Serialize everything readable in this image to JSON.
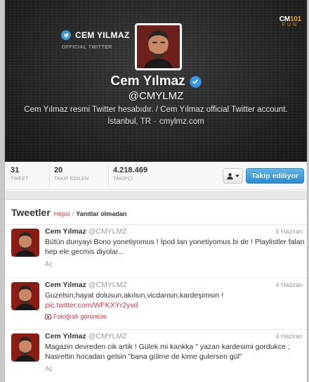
{
  "header": {
    "brand_name": "CEM YILMAZ",
    "brand_sub": "OFFICIAL TWITTER",
    "cm_logo_main": "CM",
    "cm_logo_num": "101",
    "cm_logo_sub": "FUN",
    "display_name": "Cem Yılmaz",
    "handle": "@CMYLMZ",
    "bio": "Cem Yılmaz resmi Twitter hesabıdır. / Cem Yılmaz official Twitter account.",
    "location": "İstanbul, TR",
    "separator": "·",
    "website": "cmylmz.com"
  },
  "stats": {
    "tweets": {
      "value": "31",
      "label": "TWEET"
    },
    "following": {
      "value": "20",
      "label": "TAKİP EDİLEN"
    },
    "followers": {
      "value": "4.218.469",
      "label": "TAKİPÇİ"
    }
  },
  "actions": {
    "follow_label": "Takip ediliyor"
  },
  "tweets_panel": {
    "title": "Tweetler",
    "tab_all": "Hepsi",
    "tab_sep": "/",
    "tab_no_replies": "Yanıtlar olmadan",
    "items": [
      {
        "name": "Cem Yılmaz",
        "handle": "@CMYLMZ",
        "date": "5 Haziran",
        "text": "Bütün dunyayi Bono yonetiyomus ! İpod tan yonetiyomus bi de ! Playlistler falan hep ele gecmis diyolar...",
        "action": "Aç"
      },
      {
        "name": "Cem Yılmaz",
        "handle": "@CMYLMZ",
        "date": "4 Haziran",
        "text": "Guzelsin,hayat dolusun,akılsın,vicdansin,kardeşimsin !",
        "link": "pic.twitter.com/WFKXYr2yvd",
        "action": "Fotoğrafı görüntüle"
      },
      {
        "name": "Cem Yılmaz",
        "handle": "@CMYLMZ",
        "date": "4 Haziran",
        "text": "Magazin devreden cik artik ! Gülek mi kankka \" yazan kardesimi gordukce ; Nasrettin hocadan gelsin \"bana gülme de kime gulersen gül\"",
        "action": "Aç"
      }
    ]
  }
}
